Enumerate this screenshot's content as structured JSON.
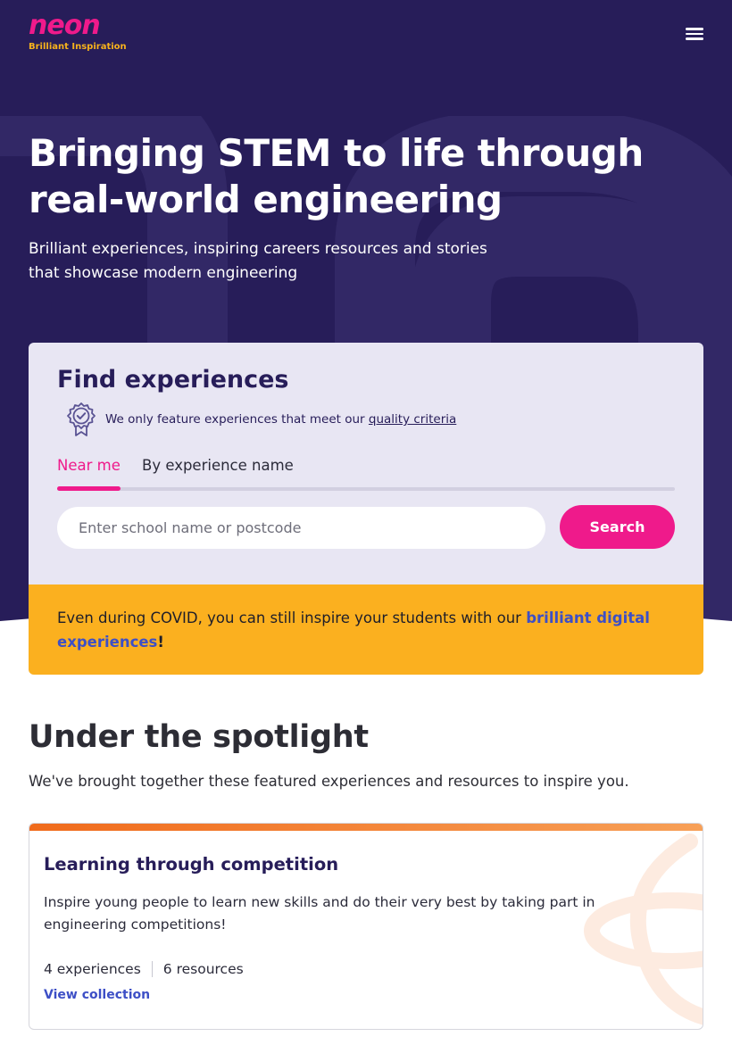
{
  "brand": {
    "logo_text": "neon",
    "tagline": "Brilliant Inspiration"
  },
  "header": {
    "menu_icon": "hamburger-menu-icon"
  },
  "hero": {
    "title_line1": "Bringing STEM to life through",
    "title_line2": "real-world engineering",
    "subtitle_line1": "Brilliant experiences, inspiring careers resources and stories",
    "subtitle_line2": "that showcase modern engineering"
  },
  "finder": {
    "title": "Find experiences",
    "quality_text": "We only feature experiences that meet our",
    "quality_link": "quality criteria",
    "quality_icon": "award-badge-icon",
    "tabs": [
      {
        "label": "Near me",
        "active": true
      },
      {
        "label": "By experience name",
        "active": false
      }
    ],
    "search_placeholder": "Enter school name or postcode",
    "search_value": "",
    "search_button": "Search"
  },
  "covid_banner": {
    "text": "Even during COVID, you can still inspire your students with our ",
    "link_line1": "brilliant digital",
    "link_line2": "experiences",
    "suffix": "!"
  },
  "spotlight": {
    "title": "Under the spotlight",
    "subtitle": "We've brought together these featured experiences and resources to inspire you.",
    "card": {
      "title": "Learning through competition",
      "description_line1": "Inspire young people to learn new skills and do their very best by taking part in",
      "description_line2": "engineering competitions!",
      "experiences": "4 experiences",
      "resources": "6 resources",
      "link": "View collection"
    }
  },
  "colors": {
    "hero_bg": "#271d59",
    "brand_pink": "#ef1a8b",
    "banner_yellow": "#fbb01f",
    "link_blue": "#3d4fc6",
    "card_accent": "#f06b1c"
  }
}
